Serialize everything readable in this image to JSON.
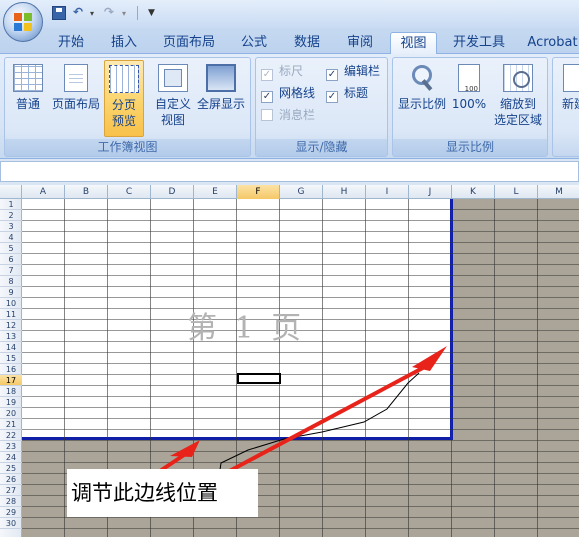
{
  "quick_access": {
    "office_button": "office-logo-icon",
    "save": "save-icon",
    "undo": "↶",
    "undo_dropdown": "▾",
    "redo": "↷",
    "redo_dropdown": "▾",
    "customize": "▼"
  },
  "tabs": [
    {
      "label": "开始"
    },
    {
      "label": "插入"
    },
    {
      "label": "页面布局"
    },
    {
      "label": "公式"
    },
    {
      "label": "数据"
    },
    {
      "label": "审阅"
    },
    {
      "label": "视图",
      "active": true
    },
    {
      "label": "开发工具"
    },
    {
      "label": "Acrobat"
    }
  ],
  "ribbon": {
    "workbook_views": {
      "label": "工作簿视图",
      "normal": "普通",
      "page_layout": "页面布局",
      "page_break_line1": "分页",
      "page_break_line2": "预览",
      "custom_line1": "自定义",
      "custom_line2": "视图",
      "full_screen": "全屏显示"
    },
    "show_hide": {
      "label": "显示/隐藏",
      "ruler": "标尺",
      "gridlines": "网格线",
      "message_bar": "消息栏",
      "formula_bar": "编辑栏",
      "headings": "标题",
      "check_mark": "✓"
    },
    "zoom": {
      "label": "显示比例",
      "zoom": "显示比例",
      "hundred": "100%",
      "hundred_icon_text": "100",
      "zoom_selection_line1": "缩放到",
      "zoom_selection_line2": "选定区域"
    },
    "window": {
      "new_window": "新建"
    }
  },
  "sheet": {
    "columns": [
      "A",
      "B",
      "C",
      "D",
      "E",
      "F",
      "G",
      "H",
      "I",
      "J",
      "K",
      "L",
      "M"
    ],
    "rows": [
      "1",
      "2",
      "3",
      "4",
      "5",
      "6",
      "7",
      "8",
      "9",
      "10",
      "11",
      "12",
      "13",
      "14",
      "15",
      "16",
      "17",
      "18",
      "19",
      "20",
      "21",
      "22",
      "23",
      "24",
      "25",
      "26",
      "27",
      "28",
      "29",
      "30"
    ],
    "active_column": "F",
    "active_row": "17",
    "page_watermark": "第 1 页",
    "colors": {
      "print_area_border": "#0f1fa8",
      "out_of_print_area": "#aaa598",
      "annotation_arrow": "#e8231a"
    }
  },
  "annotation": {
    "text": "调节此边线位置"
  }
}
